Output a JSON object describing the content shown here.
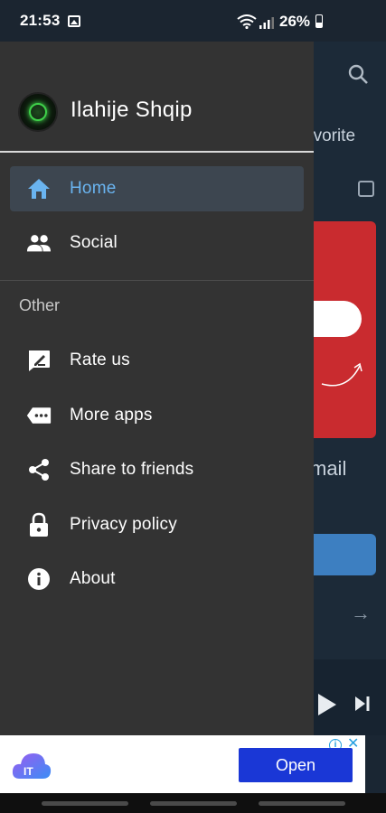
{
  "status_bar": {
    "time": "21:53",
    "battery": "26%"
  },
  "drawer": {
    "app_title": "Ilahije Shqip",
    "items": [
      {
        "label": "Home",
        "icon": "home-icon",
        "active": true
      },
      {
        "label": "Social",
        "icon": "people-icon",
        "active": false
      }
    ],
    "section_title": "Other",
    "other_items": [
      {
        "label": "Rate us",
        "icon": "rate-icon"
      },
      {
        "label": "More apps",
        "icon": "more-apps-icon"
      },
      {
        "label": "Share to friends",
        "icon": "share-icon"
      },
      {
        "label": "Privacy policy",
        "icon": "lock-icon"
      },
      {
        "label": "About",
        "icon": "info-icon"
      }
    ]
  },
  "background": {
    "tab_label": "avorite",
    "email_label": "mail"
  },
  "ad": {
    "open_label": "Open"
  },
  "colors": {
    "drawer_bg": "#333333",
    "active_bg": "#3d4650",
    "accent": "#6ab4f0",
    "ad_button": "#1a37d6"
  }
}
